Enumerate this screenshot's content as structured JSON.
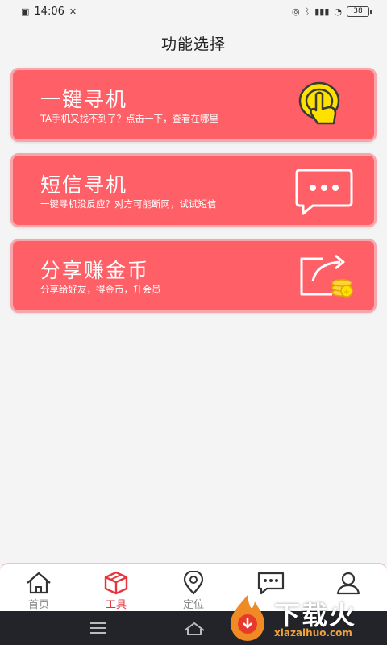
{
  "status_bar": {
    "time": "14:06",
    "battery": "38"
  },
  "page": {
    "title": "功能选择"
  },
  "cards": [
    {
      "title": "一键寻机",
      "subtitle": "TA手机又找不到了？点击一下，查看在哪里",
      "icon": "tap-hand-icon"
    },
    {
      "title": "短信寻机",
      "subtitle": "一键寻机没反应？对方可能断网，试试短信",
      "icon": "message-bubble-icon"
    },
    {
      "title": "分享赚金币",
      "subtitle": "分享给好友，得金币，升会员",
      "icon": "share-coins-icon"
    }
  ],
  "bottom_nav": [
    {
      "label": "首页",
      "icon": "home-icon",
      "active": false
    },
    {
      "label": "工具",
      "icon": "toolbox-icon",
      "active": true
    },
    {
      "label": "定位",
      "icon": "location-pin-icon",
      "active": false
    },
    {
      "label": "",
      "icon": "chat-icon",
      "active": false
    },
    {
      "label": "",
      "icon": "user-icon",
      "active": false
    }
  ],
  "watermark": {
    "brand": "下载火",
    "site": "xiazaihuo.com"
  },
  "colors": {
    "card": "#ff6068",
    "card_border": "#f7a6ab",
    "accent": "#e8343c",
    "icon_yellow": "#ffe100"
  }
}
